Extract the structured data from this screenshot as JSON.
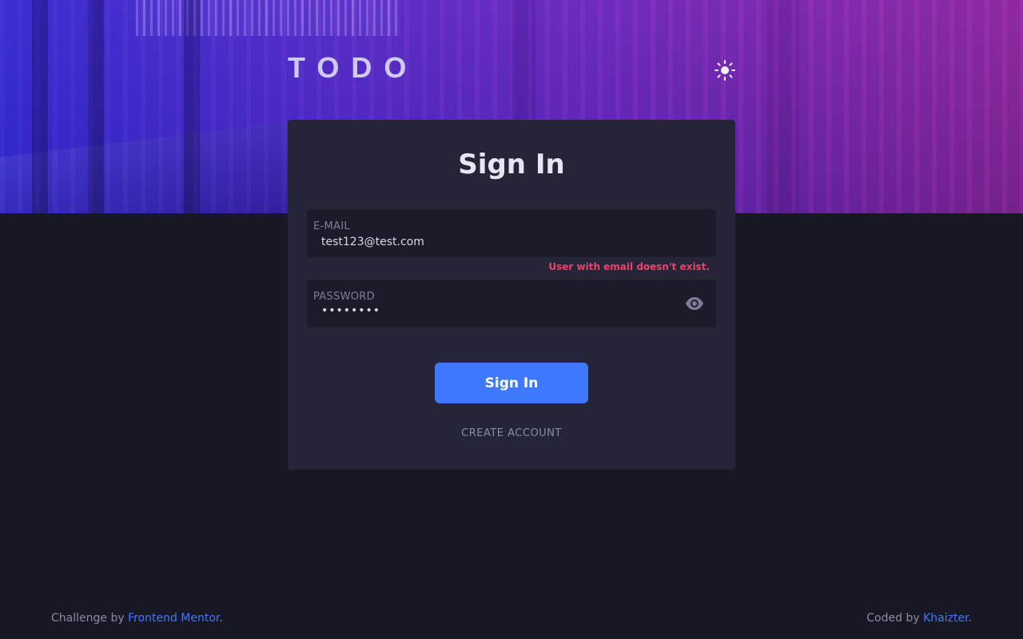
{
  "header": {
    "logo": "TODO",
    "theme_toggle_icon": "sun-icon"
  },
  "signin": {
    "title": "Sign In",
    "email": {
      "label": "E-MAIL",
      "value": "test123@test.com",
      "error": "User with email doesn't exist."
    },
    "password": {
      "label": "PASSWORD",
      "value": "••••••••",
      "toggle_icon": "eye-icon"
    },
    "submit_label": "Sign In",
    "create_account_label": "CREATE ACCOUNT"
  },
  "footer": {
    "left_prefix": "Challenge by ",
    "left_link": "Frontend Mentor",
    "left_suffix": ".",
    "right_prefix": "Coded by ",
    "right_link": "Khaizter",
    "right_suffix": "."
  },
  "colors": {
    "background": "#181824",
    "card": "#242638",
    "field": "#1b1c2a",
    "accent": "#3e78fb",
    "error": "#e6456b",
    "hero_start": "#3a2fd0",
    "hero_end": "#8f2aa0"
  }
}
